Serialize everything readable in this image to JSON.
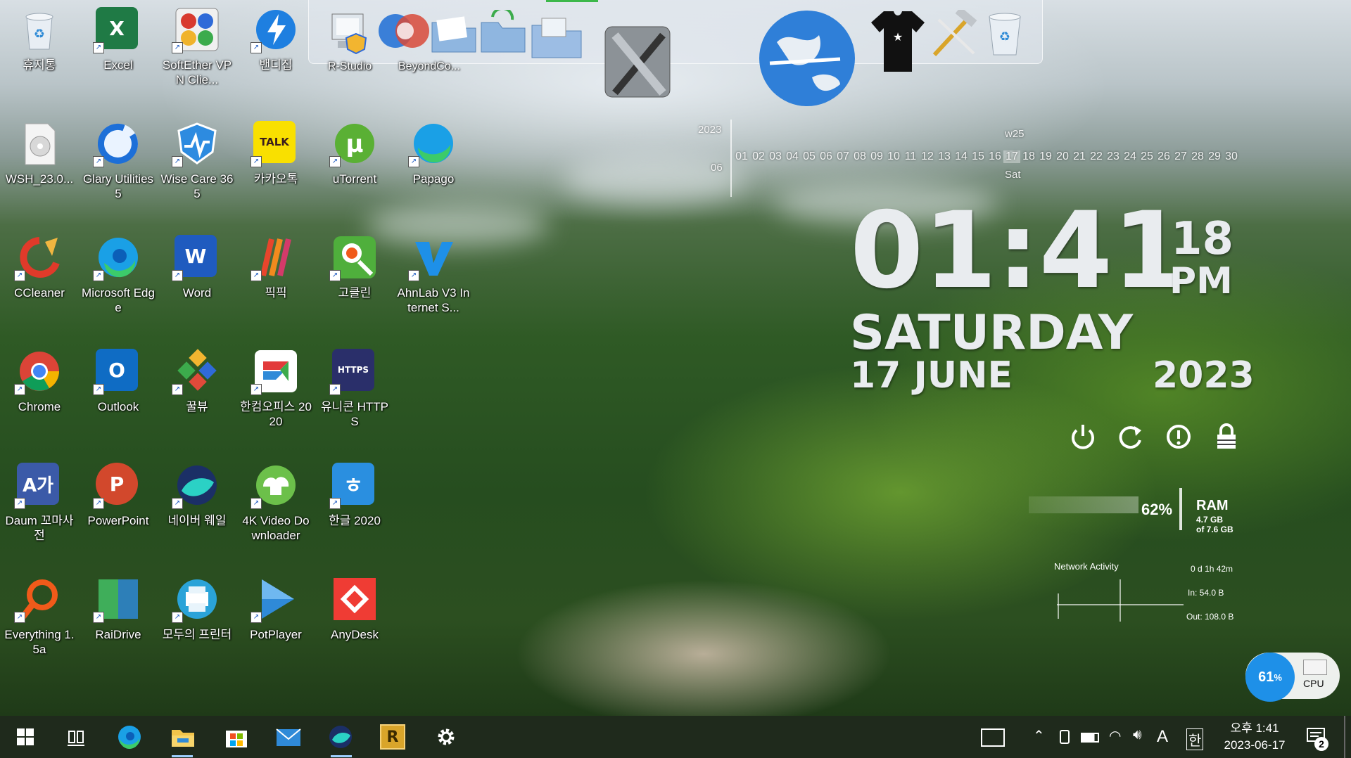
{
  "desktop": {
    "icons": [
      {
        "label": "휴지통"
      },
      {
        "label": "Excel"
      },
      {
        "label": "SoftEther VPN Clie..."
      },
      {
        "label": "밴디집"
      },
      {
        "label": "WSH_23.0..."
      },
      {
        "label": "Glary Utilities 5"
      },
      {
        "label": "Wise Care 365"
      },
      {
        "label": "카카오톡"
      },
      {
        "label": "uTorrent"
      },
      {
        "label": "Papago"
      },
      {
        "label": "CCleaner"
      },
      {
        "label": "Microsoft Edge"
      },
      {
        "label": "Word"
      },
      {
        "label": "픽픽"
      },
      {
        "label": "고클린"
      },
      {
        "label": "AhnLab V3 Internet S..."
      },
      {
        "label": "Chrome"
      },
      {
        "label": "Outlook"
      },
      {
        "label": "꿀뷰"
      },
      {
        "label": "한컴오피스 2020"
      },
      {
        "label": "유니콘 HTTPS"
      },
      {
        "label": "Daum 꼬마사전"
      },
      {
        "label": "PowerPoint"
      },
      {
        "label": "네이버 웨일"
      },
      {
        "label": "4K Video Downloader"
      },
      {
        "label": "한글 2020"
      },
      {
        "label": "Everything 1.5a"
      },
      {
        "label": "RaiDrive"
      },
      {
        "label": "모두의 프린터"
      },
      {
        "label": "PotPlayer"
      },
      {
        "label": "AnyDesk"
      }
    ]
  },
  "dock": {
    "labels": [
      "R-Studio",
      "BeyondCo..."
    ],
    "icons": [
      "r-studio-icon",
      "beyond-compare-icon",
      "folder-icon",
      "folder-sync-icon",
      "folder-docs-icon",
      "tools-icon",
      "globe-icon",
      "tshirt-icon",
      "hammer-icon",
      "recycle-bin-icon"
    ]
  },
  "calendar": {
    "year": "2023",
    "month": "06",
    "week": "w25",
    "days": [
      "01",
      "02",
      "03",
      "04",
      "05",
      "06",
      "07",
      "08",
      "09",
      "10",
      "11",
      "12",
      "13",
      "14",
      "15",
      "16",
      "17",
      "18",
      "19",
      "20",
      "21",
      "22",
      "23",
      "24",
      "25",
      "26",
      "27",
      "28",
      "29",
      "30"
    ],
    "today_day": "Sat"
  },
  "clock": {
    "time": "01:41",
    "seconds": "18",
    "ampm": "PM",
    "weekday": "SATURDAY",
    "date": "17 JUNE",
    "year": "2023"
  },
  "power_controls": [
    "power-icon",
    "restart-icon",
    "info-icon",
    "lock-icon"
  ],
  "ram": {
    "percent": "62%",
    "label": "RAM",
    "used": "4.7 GB",
    "total": "of 7.6 GB"
  },
  "network": {
    "title": "Network Activity",
    "uptime": "0 d 1h 42m",
    "in": "In: 54.0 B",
    "out": "Out: 108.0 B"
  },
  "cpu": {
    "percent": "61",
    "unit": "%",
    "label": "CPU"
  },
  "taskbar": {
    "apps": [
      "windows-start-icon",
      "task-view-icon",
      "edge-icon",
      "file-explorer-icon",
      "store-icon",
      "mail-icon",
      "whale-icon",
      "rstudio-icon",
      "settings-icon"
    ],
    "ime_a": "A",
    "ime_han": "한",
    "clock_time": "오후 1:41",
    "clock_date": "2023-06-17",
    "notification_count": "2"
  },
  "colors": {
    "taskbar": "#1f2a1c",
    "cpu_bubble": "#1e90e8",
    "clock_text": "#e9ecef"
  }
}
